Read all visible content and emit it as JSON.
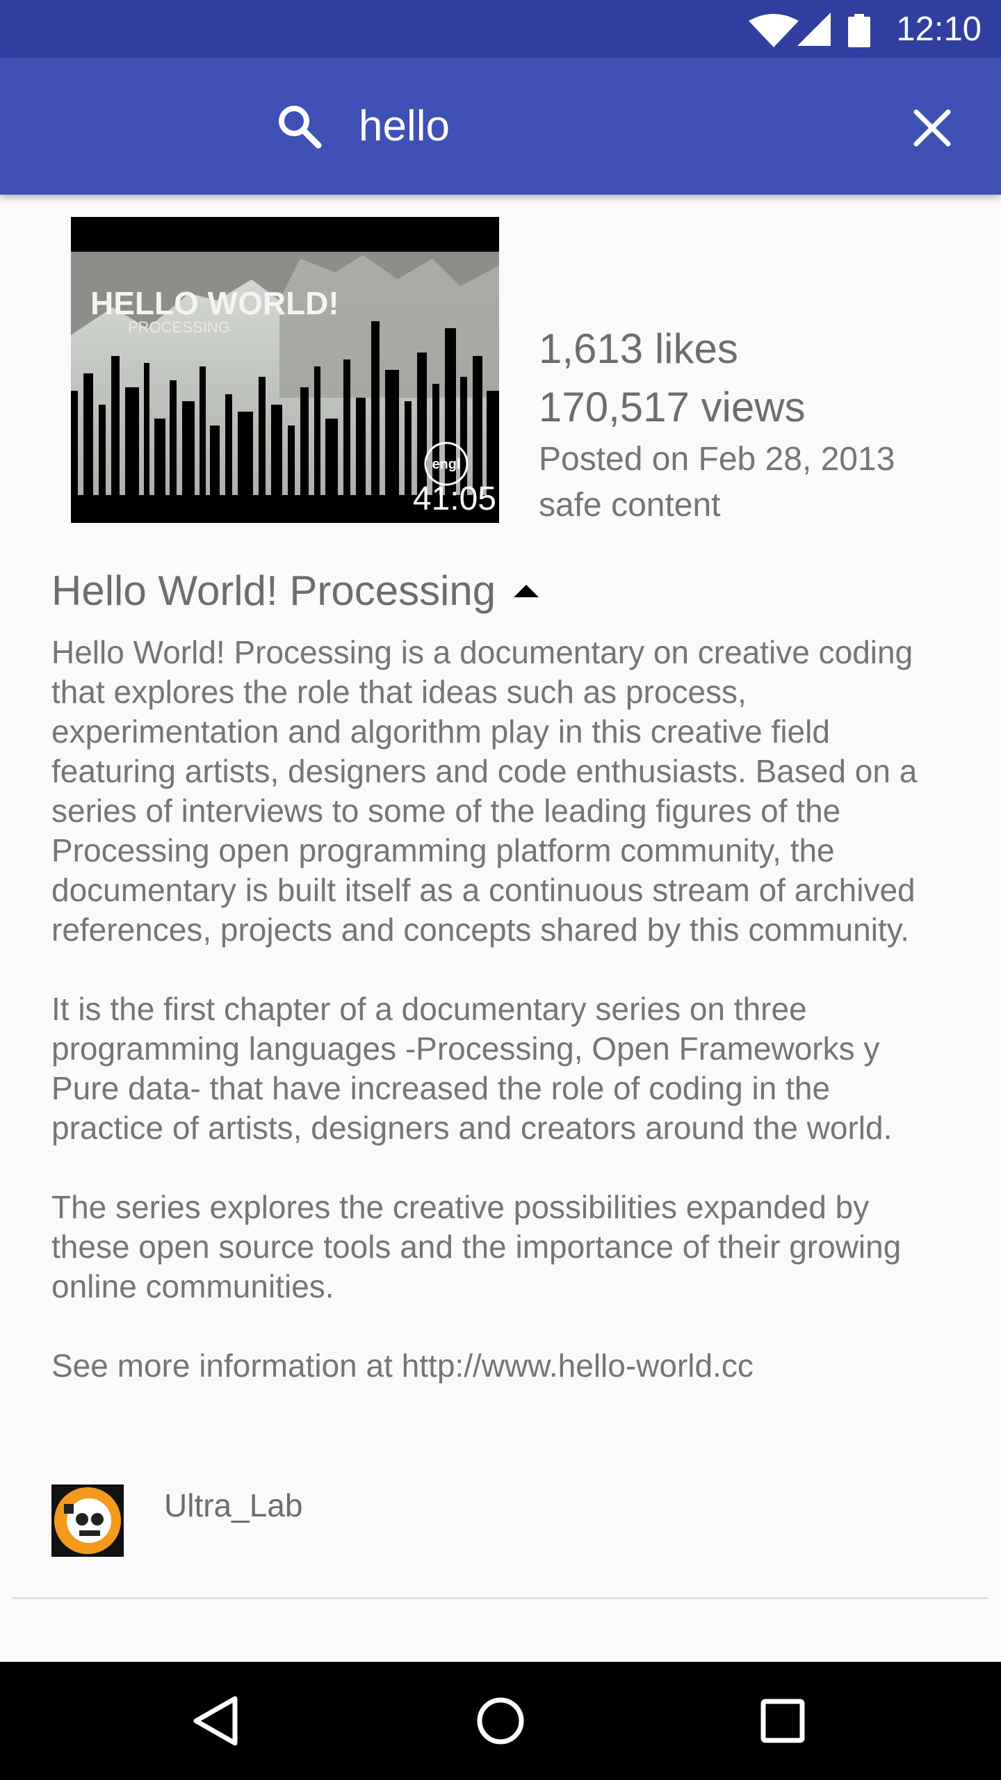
{
  "status_bar": {
    "time": "12:10",
    "icons": [
      "wifi-icon",
      "signal-icon",
      "battery-icon"
    ]
  },
  "toolbar": {
    "search_query": "hello",
    "search_icon": "search-icon",
    "close_icon": "close-icon"
  },
  "video": {
    "thumbnail": {
      "overlay_title": "HELLO WORLD!",
      "overlay_subtitle": "PROCESSING",
      "overlay_logo": "engl",
      "duration": "41:05"
    },
    "likes": "1,613 likes",
    "views": "170,517 views",
    "posted": "Posted on Feb 28, 2013",
    "rating": "safe content",
    "title": "Hello World! Processing",
    "description": [
      "Hello World! Processing is a documentary on creative coding that explores the role that ideas such as process, experimentation and algorithm play in this creative field featuring artists, designers and code enthusiasts.  Based on a series of interviews to some of the leading figures of the Processing open programming platform community, the documentary is built itself as a continuous stream of archived references, projects and concepts shared by this community.",
      "It is the first chapter of a documentary series on three programming languages -Processing, Open Frameworks y Pure data- that have increased the role of coding in the practice of artists, designers and creators around the world.",
      "The series explores the creative possibilities expanded by these open source tools and the importance of their growing online communities.",
      "See more information at http://www.hello-world.cc"
    ],
    "channel": "Ultra_Lab"
  },
  "colors": {
    "status_bar": "#303f9f",
    "toolbar": "#3f51b5",
    "background": "#fafafa",
    "text": "#757575"
  },
  "nav_bar": {
    "buttons": [
      "back-icon",
      "home-icon",
      "recents-icon"
    ]
  }
}
